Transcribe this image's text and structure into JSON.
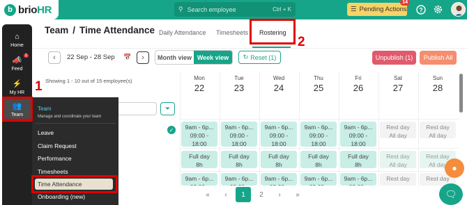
{
  "topbar": {
    "brand": "brio",
    "brand_suffix": "HR",
    "search_placeholder": "Search employee",
    "search_shortcut": "Ctrl + K",
    "pending_label": "Pending Actions",
    "pending_count": "14"
  },
  "sidebar": {
    "items": [
      {
        "label": "Home"
      },
      {
        "label": "Feed",
        "badge": "1"
      },
      {
        "label": "My HR"
      },
      {
        "label": "Team"
      }
    ]
  },
  "annotations": {
    "one": "1",
    "two": "2"
  },
  "header": {
    "breadcrumb_root": "Team",
    "breadcrumb_sep": "/",
    "breadcrumb_page": "Time Attendance",
    "tabs": [
      {
        "label": "Daily Attendance"
      },
      {
        "label": "Timesheets"
      },
      {
        "label": "Rostering"
      }
    ]
  },
  "controls": {
    "date_range": "22 Sep - 28 Sep",
    "month_view": "Month view",
    "week_view": "Week view",
    "reset": "Reset (1)",
    "unpublish": "Unpublish (1)",
    "publish_all": "Publish All"
  },
  "roster": {
    "showing": "Showing 1 - 10 out of 15 employee(s)",
    "days": [
      {
        "name": "Mon",
        "date": "22"
      },
      {
        "name": "Tue",
        "date": "23"
      },
      {
        "name": "Wed",
        "date": "24"
      },
      {
        "name": "Thu",
        "date": "25"
      },
      {
        "name": "Fri",
        "date": "26"
      },
      {
        "name": "Sat",
        "date": "27"
      },
      {
        "name": "Sun",
        "date": "28"
      }
    ],
    "shift_title": "9am - 6p...",
    "shift_time1": "09:00 -",
    "shift_time2": "18:00",
    "fullday": "Full day",
    "fullday_hours": "8h",
    "rest": "Rest day",
    "allday": "All day"
  },
  "menu": {
    "title": "Team",
    "subtitle": "Manage and coordinate your team",
    "items": [
      {
        "label": "Leave"
      },
      {
        "label": "Claim Request"
      },
      {
        "label": "Performance"
      },
      {
        "label": "Timesheets"
      },
      {
        "label": "Time Attendance"
      },
      {
        "label": "Onboarding (new)"
      }
    ]
  },
  "pagination": {
    "pages": [
      "1",
      "2"
    ]
  }
}
